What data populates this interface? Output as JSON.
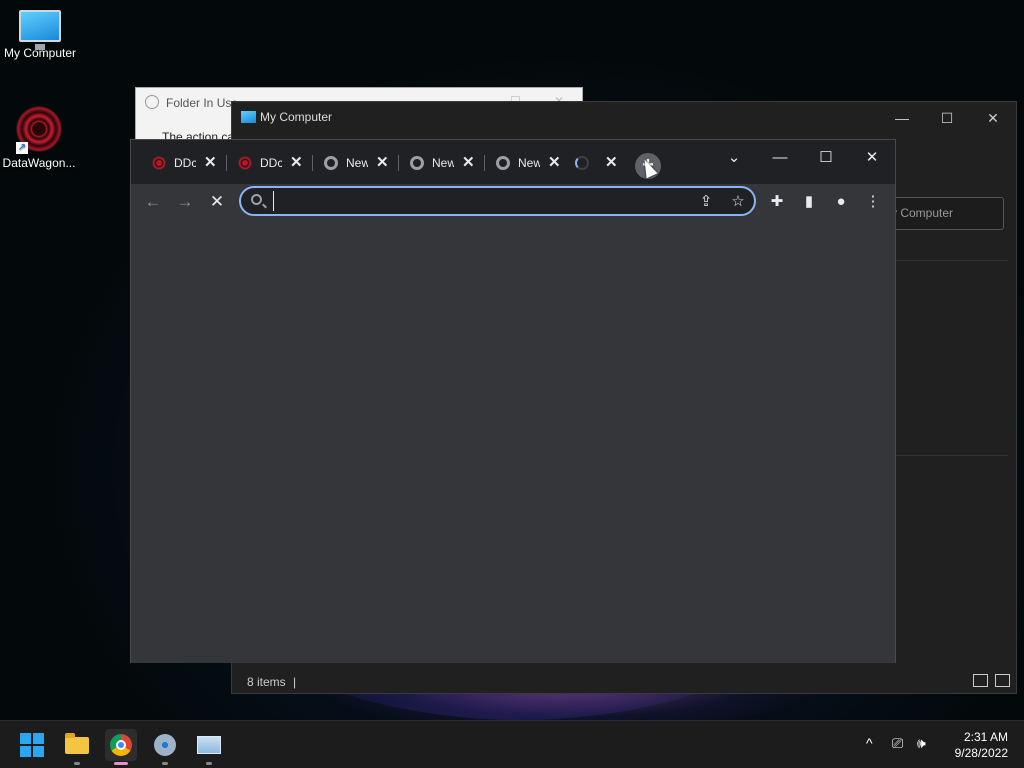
{
  "desktop": {
    "icons": [
      {
        "label": "My Computer",
        "icon": "monitor-icon"
      },
      {
        "label": "DataWagon...",
        "icon": "datawagon-logo-icon"
      }
    ]
  },
  "folder_dialog": {
    "title": "Folder In Use",
    "body": "The action ca"
  },
  "my_computer_window": {
    "title": "My Computer",
    "address": "My Computer",
    "status_items": "8 items",
    "status_sep": "|"
  },
  "chrome": {
    "tabs": [
      {
        "label": "DDc",
        "favicon": "datawagon-icon"
      },
      {
        "label": "DDc",
        "favicon": "datawagon-icon"
      },
      {
        "label": "New",
        "favicon": "new-tab-icon"
      },
      {
        "label": "New",
        "favicon": "new-tab-icon"
      },
      {
        "label": "New",
        "favicon": "new-tab-icon"
      },
      {
        "label": "",
        "favicon": "loading-spinner-icon"
      }
    ],
    "new_tab_symbol": "+",
    "tab_close_symbol": "✕",
    "omnibox": {
      "value": "",
      "placeholder": ""
    },
    "icons": {
      "back": "←",
      "forward": "→",
      "stop": "✕",
      "share": "⇪",
      "star": "☆",
      "extensions": "✚",
      "sidepanel": "▮",
      "profile": "●",
      "menu": "⋮",
      "tab_search": "⌄",
      "minimize": "—",
      "maximize": "☐",
      "close": "✕"
    }
  },
  "taskbar": {
    "apps": [
      "start-button",
      "file-explorer",
      "chrome",
      "settings",
      "task-monitor"
    ],
    "tray": {
      "chevron": "^",
      "network": "⎚",
      "volume": "🕪"
    },
    "time": "2:31 AM",
    "date": "9/28/2022"
  },
  "colors": {
    "chrome_frame": "#202124",
    "chrome_content": "#35363a",
    "omnibox_focus": "#8ab4f8",
    "taskbar": "#1c1c1c"
  }
}
